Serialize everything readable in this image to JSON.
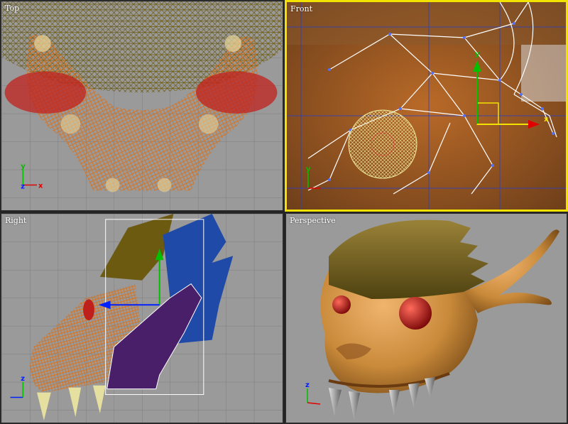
{
  "viewports": {
    "top": {
      "label": "Top"
    },
    "front": {
      "label": "Front"
    },
    "right": {
      "label": "Right"
    },
    "perspective": {
      "label": "Perspective"
    }
  },
  "axes": {
    "x": "x",
    "y": "y",
    "z": "z"
  },
  "active_viewport": "front",
  "colors": {
    "viewport_bg": "#9a9a9a",
    "active_border": "#f2e200",
    "mesh_orange": "#d9701a",
    "mesh_olive": "#6b5a10",
    "eye_red": "#c0201c",
    "gizmo_y": "#00c000",
    "gizmo_x": "#e00000",
    "gizmo_z": "#0020ff"
  }
}
